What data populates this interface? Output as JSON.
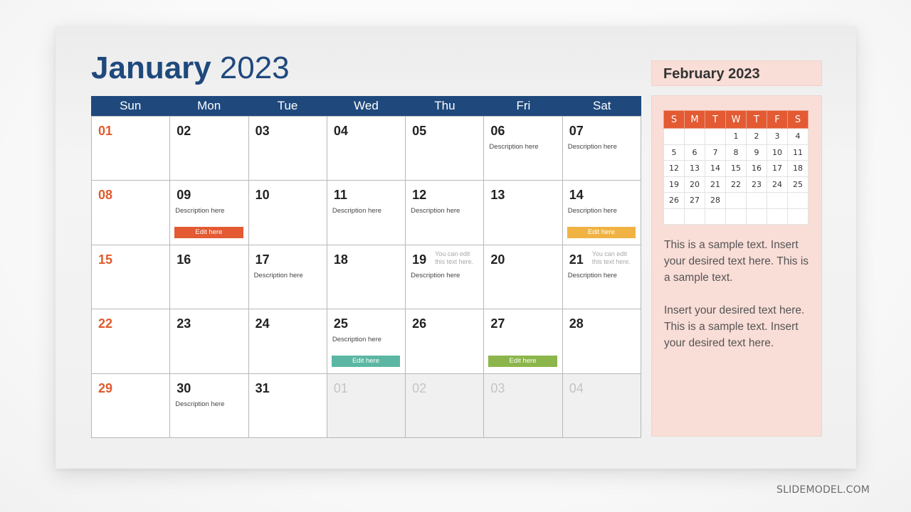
{
  "title": {
    "month": "January",
    "year": "2023"
  },
  "weekdays": [
    "Sun",
    "Mon",
    "Tue",
    "Wed",
    "Thu",
    "Fri",
    "Sat"
  ],
  "colors": {
    "header_blue": "#1f497d",
    "sunday_red": "#e05a2b",
    "edit_red": "#e35a33",
    "edit_yellow": "#f0b343",
    "edit_teal": "#5bb7a3",
    "edit_green": "#8cb64b",
    "side_panel_bg": "#f9ddd7"
  },
  "days": [
    {
      "num": "01",
      "sunday": true
    },
    {
      "num": "02"
    },
    {
      "num": "03"
    },
    {
      "num": "04"
    },
    {
      "num": "05"
    },
    {
      "num": "06",
      "desc": "Description here"
    },
    {
      "num": "07",
      "desc": "Description here"
    },
    {
      "num": "08",
      "sunday": true
    },
    {
      "num": "09",
      "desc": "Description here",
      "edit": "Edit here",
      "edit_color": "#e35a33"
    },
    {
      "num": "10"
    },
    {
      "num": "11",
      "desc": "Description here"
    },
    {
      "num": "12",
      "desc": "Description here"
    },
    {
      "num": "13"
    },
    {
      "num": "14",
      "desc": "Description here",
      "edit": "Edit here",
      "edit_color": "#f0b343"
    },
    {
      "num": "15",
      "sunday": true
    },
    {
      "num": "16"
    },
    {
      "num": "17",
      "desc": "Description here"
    },
    {
      "num": "18"
    },
    {
      "num": "19",
      "note": "You can edit this text here.",
      "desc": "Description here"
    },
    {
      "num": "20"
    },
    {
      "num": "21",
      "note": "You can edit this text here.",
      "desc": "Description here"
    },
    {
      "num": "22",
      "sunday": true
    },
    {
      "num": "23"
    },
    {
      "num": "24"
    },
    {
      "num": "25",
      "desc": "Description here",
      "edit": "Edit here",
      "edit_color": "#5bb7a3"
    },
    {
      "num": "26"
    },
    {
      "num": "27",
      "edit": "Edit here",
      "edit_color": "#8cb64b"
    },
    {
      "num": "28"
    },
    {
      "num": "29",
      "sunday": true
    },
    {
      "num": "30",
      "desc": "Description here"
    },
    {
      "num": "31"
    },
    {
      "num": "01",
      "other": true
    },
    {
      "num": "02",
      "other": true
    },
    {
      "num": "03",
      "other": true
    },
    {
      "num": "04",
      "other": true
    }
  ],
  "sidebar": {
    "title": "February 2023",
    "mini_weekdays": [
      "S",
      "M",
      "T",
      "W",
      "T",
      "F",
      "S"
    ],
    "mini_weeks": [
      [
        "",
        "",
        "",
        "1",
        "2",
        "3",
        "4"
      ],
      [
        "5",
        "6",
        "7",
        "8",
        "9",
        "10",
        "11"
      ],
      [
        "12",
        "13",
        "14",
        "15",
        "16",
        "17",
        "18"
      ],
      [
        "19",
        "20",
        "21",
        "22",
        "23",
        "24",
        "25"
      ],
      [
        "26",
        "27",
        "28",
        "",
        "",
        "",
        ""
      ],
      [
        "",
        "",
        "",
        "",
        "",
        "",
        ""
      ]
    ],
    "paragraphs": [
      "This is a sample text. Insert your desired text here. This is a sample text.",
      "Insert your desired text here. This is a sample text. Insert your desired text here."
    ]
  },
  "watermark": "SLIDEMODEL.COM"
}
